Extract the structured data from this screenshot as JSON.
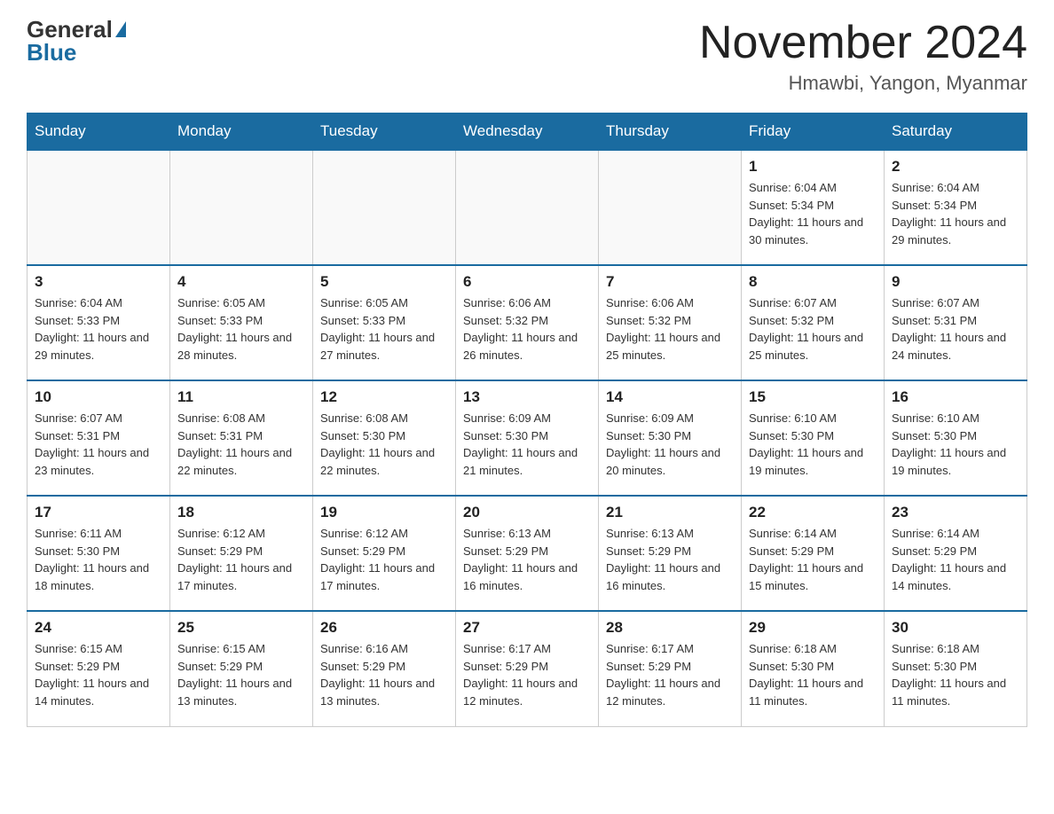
{
  "logo": {
    "general": "General",
    "blue": "Blue"
  },
  "header": {
    "month_year": "November 2024",
    "location": "Hmawbi, Yangon, Myanmar"
  },
  "days_of_week": [
    "Sunday",
    "Monday",
    "Tuesday",
    "Wednesday",
    "Thursday",
    "Friday",
    "Saturday"
  ],
  "weeks": [
    [
      {
        "day": "",
        "info": ""
      },
      {
        "day": "",
        "info": ""
      },
      {
        "day": "",
        "info": ""
      },
      {
        "day": "",
        "info": ""
      },
      {
        "day": "",
        "info": ""
      },
      {
        "day": "1",
        "info": "Sunrise: 6:04 AM\nSunset: 5:34 PM\nDaylight: 11 hours and 30 minutes."
      },
      {
        "day": "2",
        "info": "Sunrise: 6:04 AM\nSunset: 5:34 PM\nDaylight: 11 hours and 29 minutes."
      }
    ],
    [
      {
        "day": "3",
        "info": "Sunrise: 6:04 AM\nSunset: 5:33 PM\nDaylight: 11 hours and 29 minutes."
      },
      {
        "day": "4",
        "info": "Sunrise: 6:05 AM\nSunset: 5:33 PM\nDaylight: 11 hours and 28 minutes."
      },
      {
        "day": "5",
        "info": "Sunrise: 6:05 AM\nSunset: 5:33 PM\nDaylight: 11 hours and 27 minutes."
      },
      {
        "day": "6",
        "info": "Sunrise: 6:06 AM\nSunset: 5:32 PM\nDaylight: 11 hours and 26 minutes."
      },
      {
        "day": "7",
        "info": "Sunrise: 6:06 AM\nSunset: 5:32 PM\nDaylight: 11 hours and 25 minutes."
      },
      {
        "day": "8",
        "info": "Sunrise: 6:07 AM\nSunset: 5:32 PM\nDaylight: 11 hours and 25 minutes."
      },
      {
        "day": "9",
        "info": "Sunrise: 6:07 AM\nSunset: 5:31 PM\nDaylight: 11 hours and 24 minutes."
      }
    ],
    [
      {
        "day": "10",
        "info": "Sunrise: 6:07 AM\nSunset: 5:31 PM\nDaylight: 11 hours and 23 minutes."
      },
      {
        "day": "11",
        "info": "Sunrise: 6:08 AM\nSunset: 5:31 PM\nDaylight: 11 hours and 22 minutes."
      },
      {
        "day": "12",
        "info": "Sunrise: 6:08 AM\nSunset: 5:30 PM\nDaylight: 11 hours and 22 minutes."
      },
      {
        "day": "13",
        "info": "Sunrise: 6:09 AM\nSunset: 5:30 PM\nDaylight: 11 hours and 21 minutes."
      },
      {
        "day": "14",
        "info": "Sunrise: 6:09 AM\nSunset: 5:30 PM\nDaylight: 11 hours and 20 minutes."
      },
      {
        "day": "15",
        "info": "Sunrise: 6:10 AM\nSunset: 5:30 PM\nDaylight: 11 hours and 19 minutes."
      },
      {
        "day": "16",
        "info": "Sunrise: 6:10 AM\nSunset: 5:30 PM\nDaylight: 11 hours and 19 minutes."
      }
    ],
    [
      {
        "day": "17",
        "info": "Sunrise: 6:11 AM\nSunset: 5:30 PM\nDaylight: 11 hours and 18 minutes."
      },
      {
        "day": "18",
        "info": "Sunrise: 6:12 AM\nSunset: 5:29 PM\nDaylight: 11 hours and 17 minutes."
      },
      {
        "day": "19",
        "info": "Sunrise: 6:12 AM\nSunset: 5:29 PM\nDaylight: 11 hours and 17 minutes."
      },
      {
        "day": "20",
        "info": "Sunrise: 6:13 AM\nSunset: 5:29 PM\nDaylight: 11 hours and 16 minutes."
      },
      {
        "day": "21",
        "info": "Sunrise: 6:13 AM\nSunset: 5:29 PM\nDaylight: 11 hours and 16 minutes."
      },
      {
        "day": "22",
        "info": "Sunrise: 6:14 AM\nSunset: 5:29 PM\nDaylight: 11 hours and 15 minutes."
      },
      {
        "day": "23",
        "info": "Sunrise: 6:14 AM\nSunset: 5:29 PM\nDaylight: 11 hours and 14 minutes."
      }
    ],
    [
      {
        "day": "24",
        "info": "Sunrise: 6:15 AM\nSunset: 5:29 PM\nDaylight: 11 hours and 14 minutes."
      },
      {
        "day": "25",
        "info": "Sunrise: 6:15 AM\nSunset: 5:29 PM\nDaylight: 11 hours and 13 minutes."
      },
      {
        "day": "26",
        "info": "Sunrise: 6:16 AM\nSunset: 5:29 PM\nDaylight: 11 hours and 13 minutes."
      },
      {
        "day": "27",
        "info": "Sunrise: 6:17 AM\nSunset: 5:29 PM\nDaylight: 11 hours and 12 minutes."
      },
      {
        "day": "28",
        "info": "Sunrise: 6:17 AM\nSunset: 5:29 PM\nDaylight: 11 hours and 12 minutes."
      },
      {
        "day": "29",
        "info": "Sunrise: 6:18 AM\nSunset: 5:30 PM\nDaylight: 11 hours and 11 minutes."
      },
      {
        "day": "30",
        "info": "Sunrise: 6:18 AM\nSunset: 5:30 PM\nDaylight: 11 hours and 11 minutes."
      }
    ]
  ]
}
